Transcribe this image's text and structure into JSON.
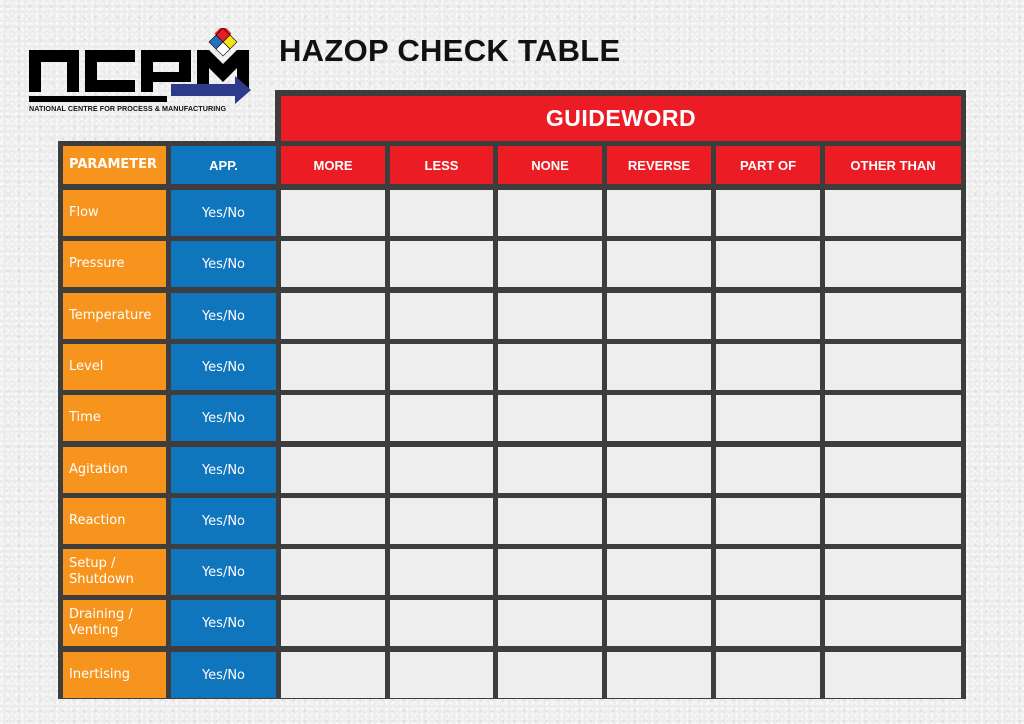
{
  "logo": {
    "letters": "ncpm",
    "tagline": "NATIONAL CENTRE FOR PROCESS & MANUFACTURING",
    "colors": {
      "black": "#000000",
      "arrow": "#2e3a8c",
      "diamond_top": "#e31e24",
      "diamond_left": "#2a6fbf",
      "diamond_right": "#f7e11a",
      "diamond_bottom": "#ffffff"
    }
  },
  "title": "HAZOP CHECK TABLE",
  "table": {
    "guideword_label": "GUIDEWORD",
    "parameter_header": "PARAMETER",
    "app_header": "APP.",
    "guidewords": [
      "MORE",
      "LESS",
      "NONE",
      "REVERSE",
      "PART OF",
      "OTHER THAN"
    ],
    "rows": [
      {
        "parameter": "Flow",
        "app": "Yes/No"
      },
      {
        "parameter": "Pressure",
        "app": "Yes/No"
      },
      {
        "parameter": "Temperature",
        "app": "Yes/No"
      },
      {
        "parameter": "Level",
        "app": "Yes/No"
      },
      {
        "parameter": "Time",
        "app": "Yes/No"
      },
      {
        "parameter": "Agitation",
        "app": "Yes/No"
      },
      {
        "parameter": "Reaction",
        "app": "Yes/No"
      },
      {
        "parameter": "Setup / Shutdown",
        "app": "Yes/No"
      },
      {
        "parameter": "Draining / Venting",
        "app": "Yes/No"
      },
      {
        "parameter": "Inertising",
        "app": "Yes/No"
      }
    ]
  },
  "colors": {
    "guideword_red": "#ec1c24",
    "parameter_orange": "#f7941d",
    "app_blue": "#0f75bc",
    "grid": "#3d3d3d"
  }
}
